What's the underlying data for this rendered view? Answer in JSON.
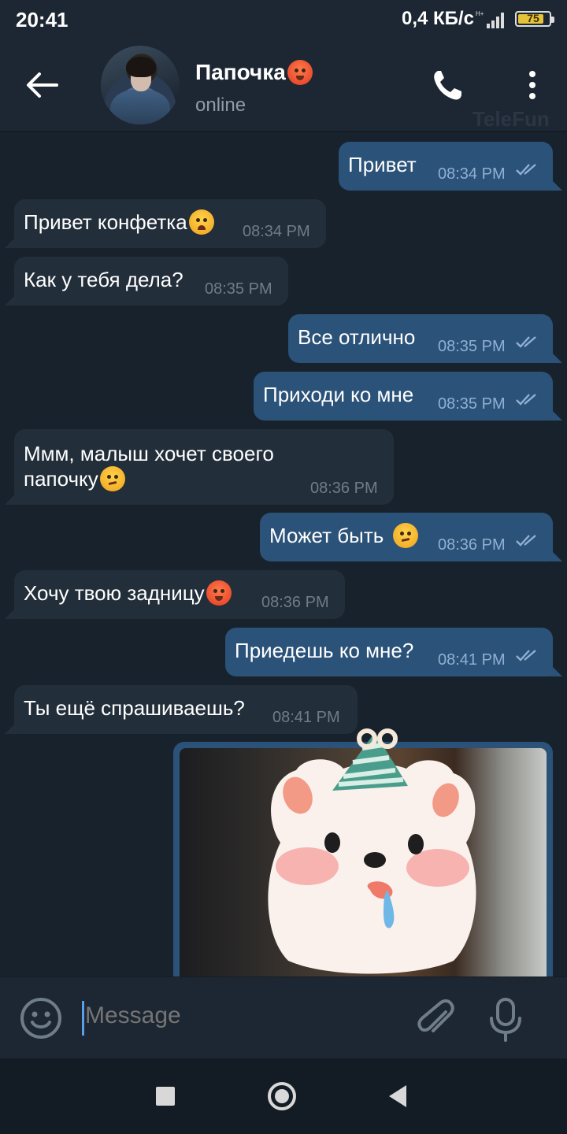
{
  "status_bar": {
    "time": "20:41",
    "speed": "0,4 КБ/с",
    "battery": "75"
  },
  "header": {
    "title": "Папочка",
    "status": "online",
    "watermark": "TeleFun"
  },
  "messages": [
    {
      "dir": "out",
      "text": "Привет",
      "time": "08:34 PM"
    },
    {
      "dir": "in",
      "text": "Привет конфетка",
      "time": "08:34 PM",
      "emoji": "worried-face-icon"
    },
    {
      "dir": "in",
      "text": "Как у тебя дела?",
      "time": "08:35 PM"
    },
    {
      "dir": "out",
      "text": "Все отлично",
      "time": "08:35 PM"
    },
    {
      "dir": "out",
      "text": "Приходи ко мне",
      "time": "08:35 PM"
    },
    {
      "dir": "in",
      "text_line1": "Ммм, малыш хочет своего",
      "text_line2": "папочку",
      "time": "08:36 PM",
      "emoji": "smirk-face-icon"
    },
    {
      "dir": "out",
      "text": "Может быть",
      "time": "08:36 PM",
      "emoji": "smirk-face-icon"
    },
    {
      "dir": "in",
      "text": "Хочу твою задницу",
      "time": "08:36 PM",
      "emoji": "hot-face-icon"
    },
    {
      "dir": "out",
      "text": "Приедешь ко мне?",
      "time": "08:41 PM"
    },
    {
      "dir": "in",
      "text": "Ты ещё спрашиваешь?",
      "time": "08:41 PM"
    }
  ],
  "input": {
    "placeholder": "Message"
  },
  "colors": {
    "background": "#18222d",
    "bubble_in": "#222e3a",
    "bubble_out": "#2b5278",
    "header": "#1d2733"
  }
}
